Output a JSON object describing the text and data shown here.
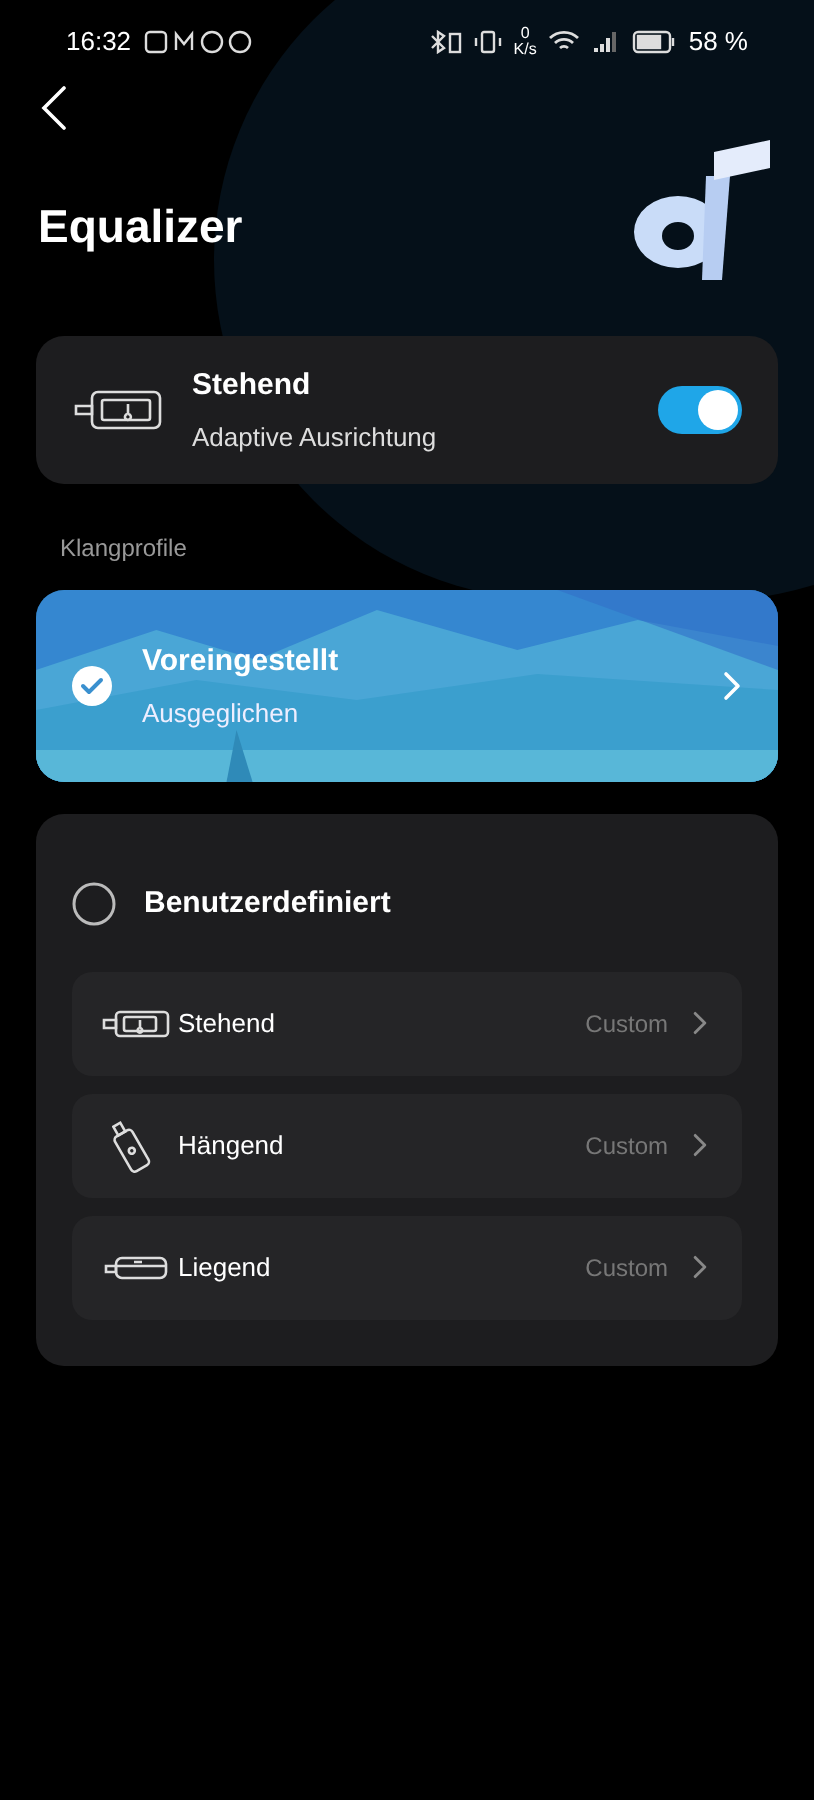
{
  "status_bar": {
    "time": "16:32",
    "speed_value": "0",
    "speed_unit": "K/s",
    "battery": "58 %"
  },
  "header": {
    "title": "Equalizer"
  },
  "orientation_card": {
    "title": "Stehend",
    "subtitle": "Adaptive Ausrichtung",
    "on": true
  },
  "section_label": "Klangprofile",
  "preset": {
    "title": "Voreingestellt",
    "subtitle": "Ausgeglichen",
    "selected": true
  },
  "custom": {
    "title": "Benutzerdefiniert",
    "selected": false,
    "items": [
      {
        "kind": "standing",
        "label": "Stehend",
        "value": "Custom"
      },
      {
        "kind": "hanging",
        "label": "Hängend",
        "value": "Custom"
      },
      {
        "kind": "lying",
        "label": "Liegend",
        "value": "Custom"
      }
    ]
  }
}
